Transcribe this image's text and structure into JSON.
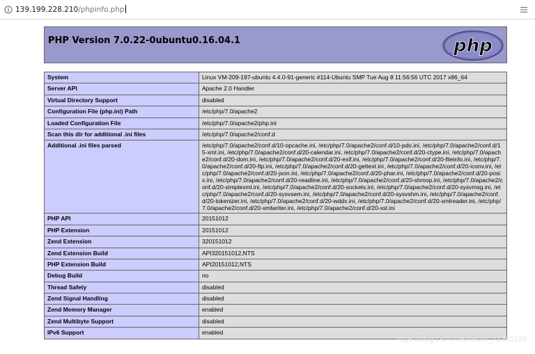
{
  "browser": {
    "url_host": "139.199.228.210",
    "url_path": "/phpinfo.php"
  },
  "header": {
    "title": "PHP Version 7.0.22-0ubuntu0.16.04.1",
    "logo_text": "php"
  },
  "rows": [
    {
      "key": "System",
      "value": "Linux VM-209-197-ubuntu 4.4.0-91-generic #114-Ubuntu SMP Tue Aug 8 11:56:56 UTC 2017 x86_64"
    },
    {
      "key": "Server API",
      "value": "Apache 2.0 Handler"
    },
    {
      "key": "Virtual Directory Support",
      "value": "disabled"
    },
    {
      "key": "Configuration File (php.ini) Path",
      "value": "/etc/php/7.0/apache2"
    },
    {
      "key": "Loaded Configuration File",
      "value": "/etc/php/7.0/apache2/php.ini"
    },
    {
      "key": "Scan this dir for additional .ini files",
      "value": "/etc/php/7.0/apache2/conf.d"
    },
    {
      "key": "Additional .ini files parsed",
      "value": "/etc/php/7.0/apache2/conf.d/10-opcache.ini, /etc/php/7.0/apache2/conf.d/10-pdo.ini, /etc/php/7.0/apache2/conf.d/15-xml.ini, /etc/php/7.0/apache2/conf.d/20-calendar.ini, /etc/php/7.0/apache2/conf.d/20-ctype.ini, /etc/php/7.0/apache2/conf.d/20-dom.ini, /etc/php/7.0/apache2/conf.d/20-exif.ini, /etc/php/7.0/apache2/conf.d/20-fileinfo.ini, /etc/php/7.0/apache2/conf.d/20-ftp.ini, /etc/php/7.0/apache2/conf.d/20-gettext.ini, /etc/php/7.0/apache2/conf.d/20-iconv.ini, /etc/php/7.0/apache2/conf.d/20-json.ini, /etc/php/7.0/apache2/conf.d/20-phar.ini, /etc/php/7.0/apache2/conf.d/20-posix.ini, /etc/php/7.0/apache2/conf.d/20-readline.ini, /etc/php/7.0/apache2/conf.d/20-shmop.ini, /etc/php/7.0/apache2/conf.d/20-simplexml.ini, /etc/php/7.0/apache2/conf.d/20-sockets.ini, /etc/php/7.0/apache2/conf.d/20-sysvmsg.ini, /etc/php/7.0/apache2/conf.d/20-sysvsem.ini, /etc/php/7.0/apache2/conf.d/20-sysvshm.ini, /etc/php/7.0/apache2/conf.d/20-tokenizer.ini, /etc/php/7.0/apache2/conf.d/20-wddx.ini, /etc/php/7.0/apache2/conf.d/20-xmlreader.ini, /etc/php/7.0/apache2/conf.d/20-xmlwriter.ini, /etc/php/7.0/apache2/conf.d/20-xsl.ini"
    },
    {
      "key": "PHP API",
      "value": "20151012"
    },
    {
      "key": "PHP Extension",
      "value": "20151012"
    },
    {
      "key": "Zend Extension",
      "value": "320151012"
    },
    {
      "key": "Zend Extension Build",
      "value": "API320151012,NTS"
    },
    {
      "key": "PHP Extension Build",
      "value": "API20151012,NTS"
    },
    {
      "key": "Debug Build",
      "value": "no"
    },
    {
      "key": "Thread Safety",
      "value": "disabled"
    },
    {
      "key": "Zend Signal Handling",
      "value": "disabled"
    },
    {
      "key": "Zend Memory Manager",
      "value": "enabled"
    },
    {
      "key": "Zend Multibyte Support",
      "value": "disabled"
    },
    {
      "key": "IPv6 Support",
      "value": "enabled"
    }
  ],
  "watermark": "https://blog.csdn.net/weixin_41363156"
}
